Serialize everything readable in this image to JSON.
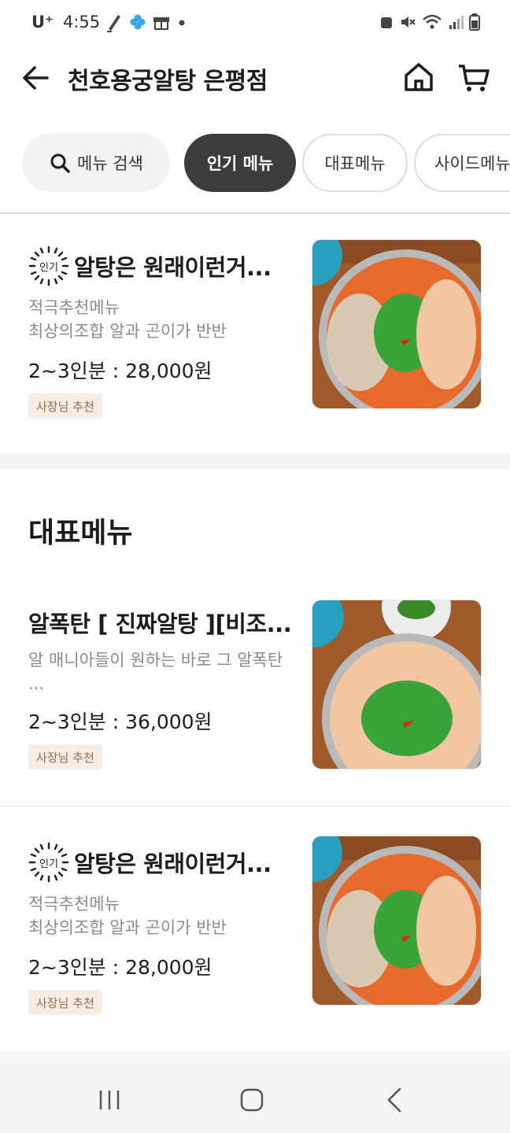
{
  "status": {
    "carrier": "U⁺",
    "time": "4:55"
  },
  "header": {
    "title": "천호용궁알탕 은평점"
  },
  "tabs": {
    "search": "메뉴 검색",
    "items": [
      "인기 메뉴",
      "대표메뉴",
      "사이드메뉴"
    ]
  },
  "popular": {
    "badge": "인기",
    "title": "알탕은 원래이런거...",
    "desc_lines": [
      "적극추천메뉴",
      "최상의조합 알과 곤이가 반반"
    ],
    "price": "2~3인분 : 28,000원",
    "tag": "사장님 추천"
  },
  "representative": {
    "section_title": "대표메뉴",
    "items": [
      {
        "title": "알폭탄 [ 진짜알탕 ][비조...",
        "desc": "알 매니아들이 원하는 바로 그 알폭탄 ...",
        "price": "2~3인분 : 36,000원",
        "tag": "사장님 추천"
      },
      {
        "badge": "인기",
        "title": "알탕은 원래이런거...",
        "desc_lines": [
          "적극추천메뉴",
          "최상의조합 알과 곤이가 반반"
        ],
        "price": "2~3인분 : 28,000원",
        "tag": "사장님 추천"
      }
    ]
  },
  "colors": {
    "active_tab": "#3c3c3c",
    "tag_bg": "#f5ede6",
    "tag_text": "#9a6a47"
  }
}
